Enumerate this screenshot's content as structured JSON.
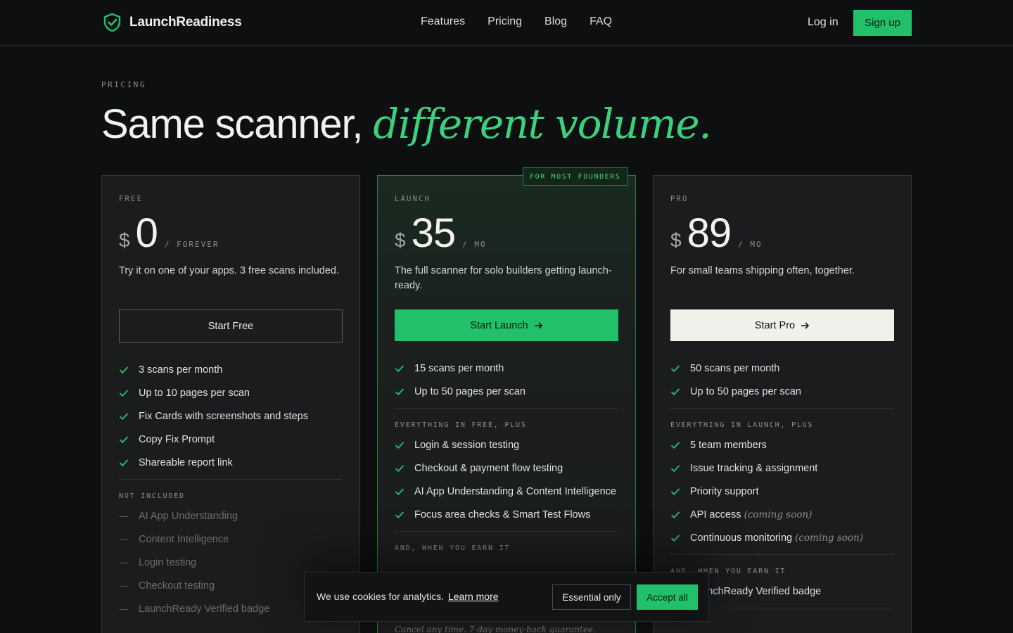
{
  "nav": {
    "brand": "LaunchReadiness",
    "links": [
      "Features",
      "Pricing",
      "Blog",
      "FAQ"
    ],
    "login": "Log in",
    "signup": "Sign up"
  },
  "hero": {
    "eyebrow": "PRICING",
    "title": "Same scanner,",
    "title_accent": "different volume."
  },
  "plans": [
    {
      "tier": "FREE",
      "currency": "$",
      "price": "0",
      "period": "/ FOREVER",
      "description": "Try it on one of your apps. 3 free scans included.",
      "cta": "Start Free",
      "features": [
        "3 scans per month",
        "Up to 10 pages per scan",
        "Fix Cards with screenshots and steps",
        "Copy Fix Prompt",
        "Shareable report link"
      ],
      "section_label": "NOT INCLUDED",
      "excluded": [
        "AI App Understanding",
        "Content Intelligence",
        "Login testing",
        "Checkout testing",
        "LaunchReady Verified badge"
      ]
    },
    {
      "tier": "LAUNCH",
      "badge": "FOR MOST FOUNDERS",
      "currency": "$",
      "price": "35",
      "period": "/ MO",
      "description": "The full scanner for solo builders getting launch-ready.",
      "cta": "Start Launch",
      "features": [
        "15 scans per month",
        "Up to 50 pages per scan"
      ],
      "section_label": "EVERYTHING IN FREE, PLUS",
      "extra": [
        "Login & session testing",
        "Checkout & payment flow testing",
        "AI App Understanding & Content Intelligence",
        "Focus area checks & Smart Test Flows"
      ],
      "earn_label": "AND, WHEN YOU EARN IT",
      "fine_print": "Cancel any time. 7-day money-back guarantee."
    },
    {
      "tier": "PRO",
      "currency": "$",
      "price": "89",
      "period": "/ MO",
      "description": "For small teams shipping often, together.",
      "cta": "Start Pro",
      "features": [
        "50 scans per month",
        "Up to 50 pages per scan"
      ],
      "section_label": "EVERYTHING IN LAUNCH, PLUS",
      "extra": [
        "5 team members",
        "Issue tracking & assignment",
        "Priority support",
        "API access",
        "Continuous monitoring"
      ],
      "extra_notes": [
        "",
        "",
        "",
        "(coming soon)",
        "(coming soon)"
      ],
      "earn_label": "AND, WHEN YOU EARN IT",
      "earn_items": [
        "LaunchReady Verified badge"
      ]
    }
  ],
  "cookie": {
    "text": "We use cookies for analytics.",
    "link": "Learn more",
    "essential": "Essential only",
    "accept": "Accept all"
  },
  "colors": {
    "accent": "#22c06b",
    "background": "#0e0f10",
    "card": "#1b1c1e"
  }
}
